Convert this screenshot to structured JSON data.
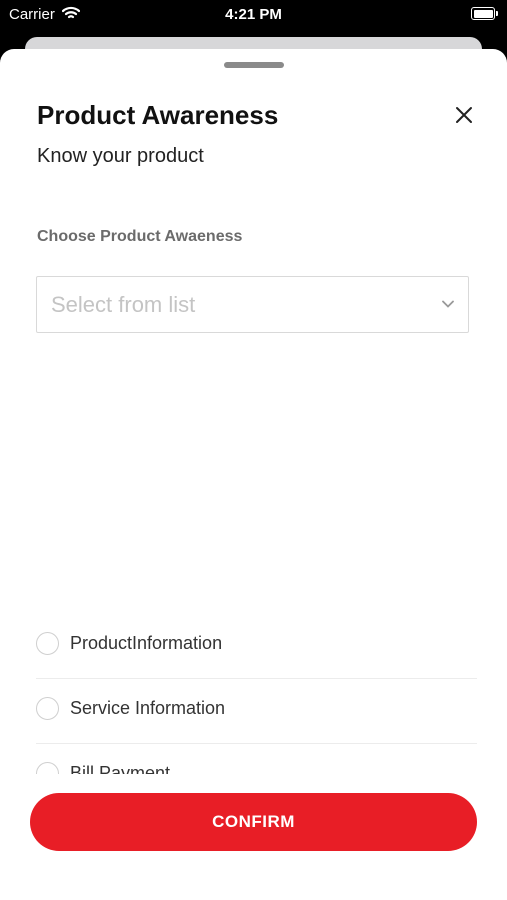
{
  "status_bar": {
    "carrier": "Carrier",
    "time": "4:21 PM",
    "wifi_icon": "wifi-icon",
    "battery_icon": "battery-icon"
  },
  "sheet": {
    "title": "Product Awareness",
    "subtitle": "Know your product",
    "close_icon": "close-icon"
  },
  "form": {
    "label": "Choose Product Awaeness",
    "select_placeholder": "Select from list",
    "chevron_icon": "chevron-down-icon"
  },
  "options": [
    {
      "label": "ProductInformation",
      "selected": false
    },
    {
      "label": "Service Information",
      "selected": false
    },
    {
      "label": "Bill Payment",
      "selected": false
    }
  ],
  "actions": {
    "confirm_label": "CONFIRM"
  },
  "colors": {
    "accent": "#e81e26",
    "label_gray": "#6b6b6b",
    "placeholder_gray": "#c4c4c4"
  }
}
